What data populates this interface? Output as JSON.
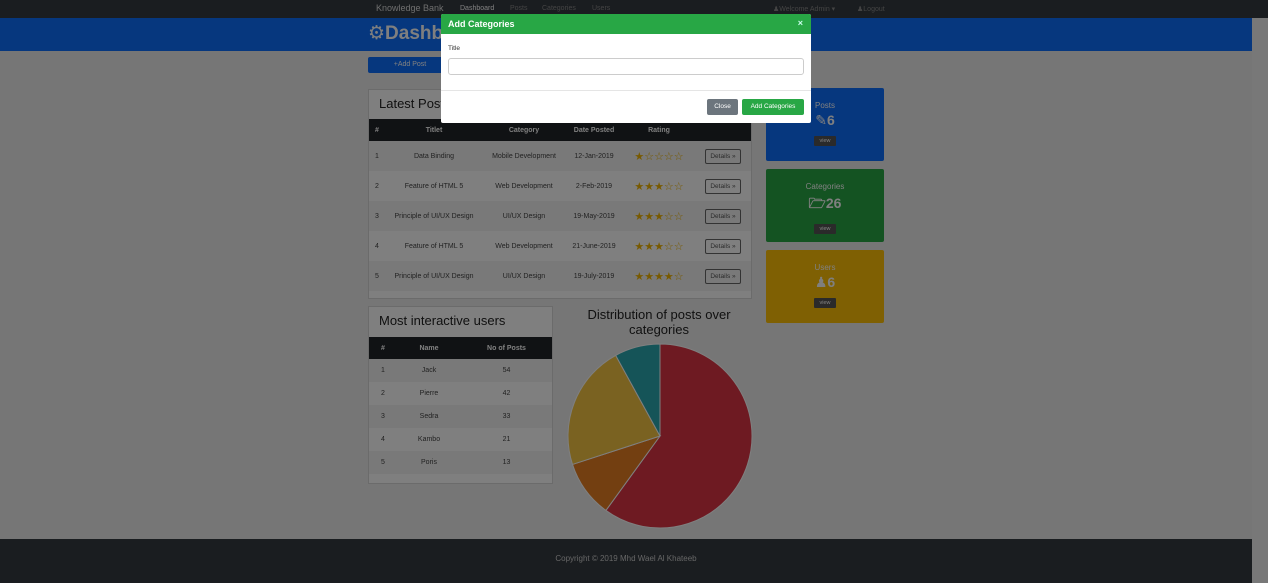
{
  "nav": {
    "brand": "Knowledge Bank",
    "links": [
      "Dashboard",
      "Posts",
      "Categories",
      "Users"
    ],
    "welcome": "Welcome Admin",
    "logout": "Logout"
  },
  "header": {
    "title": "Dashboard"
  },
  "add_post": "Add Post",
  "latest_posts": {
    "title": "Latest Posts",
    "columns": [
      "#",
      "Titlet",
      "Category",
      "Date Posted",
      "Rating",
      ""
    ],
    "rows": [
      {
        "n": "1",
        "title": "Data Binding",
        "category": "Mobile Development",
        "date": "12-Jan-2019",
        "rating": "★☆☆☆☆",
        "action": "Details »"
      },
      {
        "n": "2",
        "title": "Feature of HTML 5",
        "category": "Web Development",
        "date": "2-Feb-2019",
        "rating": "★★★☆☆",
        "action": "Details »"
      },
      {
        "n": "3",
        "title": "Principle of UI/UX Design",
        "category": "UI/UX Design",
        "date": "19-May-2019",
        "rating": "★★★☆☆",
        "action": "Details »"
      },
      {
        "n": "4",
        "title": "Feature of HTML 5",
        "category": "Web Development",
        "date": "21-June-2019",
        "rating": "★★★☆☆",
        "action": "Details »"
      },
      {
        "n": "5",
        "title": "Principle of UI/UX Design",
        "category": "UI/UX Design",
        "date": "19-July-2019",
        "rating": "★★★★☆",
        "action": "Details »"
      }
    ]
  },
  "stats": [
    {
      "label": "Posts",
      "value": "6",
      "view": "view",
      "color": "#0d6efd",
      "icon": "pencil-icon"
    },
    {
      "label": "Categories",
      "value": "26",
      "view": "view",
      "color": "#28a745",
      "icon": "folder-open-icon"
    },
    {
      "label": "Users",
      "value": "6",
      "view": "view",
      "color": "#ffc107",
      "icon": "users-icon"
    }
  ],
  "users": {
    "title": "Most interactive users",
    "columns": [
      "#",
      "Name",
      "No of Posts"
    ],
    "rows": [
      {
        "n": "1",
        "name": "Jack",
        "posts": "54"
      },
      {
        "n": "2",
        "name": "Pierre",
        "posts": "42"
      },
      {
        "n": "3",
        "name": "Sedra",
        "posts": "33"
      },
      {
        "n": "4",
        "name": "Kambo",
        "posts": "21"
      },
      {
        "n": "5",
        "name": "Poris",
        "posts": "13"
      }
    ]
  },
  "chart_data": {
    "type": "pie",
    "title": "Distribution of posts over categories",
    "values": [
      60,
      10,
      22,
      8
    ],
    "colors": [
      "#dc3545",
      "#e67e22",
      "#f4c542",
      "#2aa8b0"
    ]
  },
  "footer": {
    "text": "Copyright © 2019 Mhd Wael Al Khateeb"
  },
  "modal": {
    "title": "Add Categories",
    "close_x": "×",
    "field_label": "Title",
    "field_value": "",
    "close_button": "Close",
    "submit_button": "Add Categories",
    "close_color": "#6c757d",
    "submit_color": "#28a745"
  }
}
